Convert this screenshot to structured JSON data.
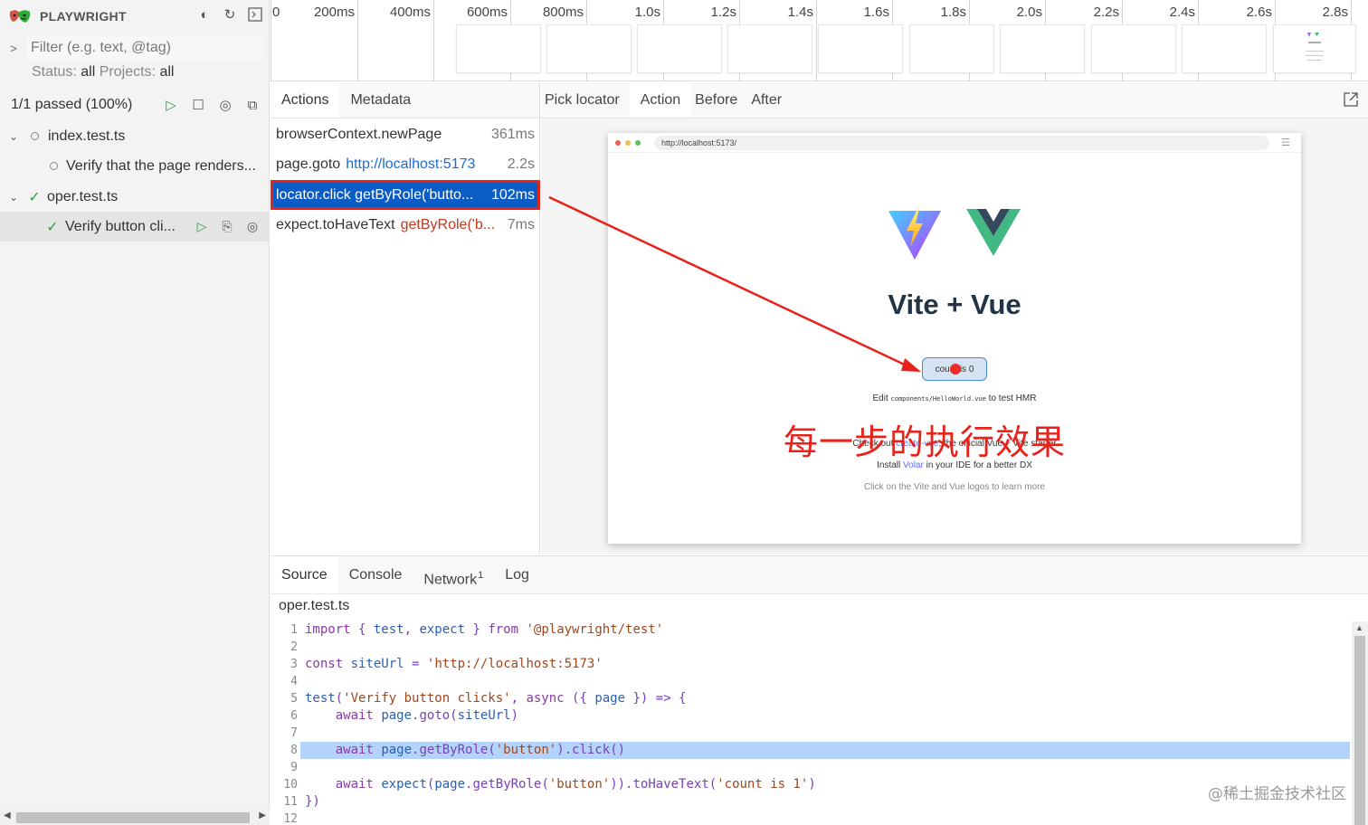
{
  "sidebar": {
    "brand": "PLAYWRIGHT",
    "filter_placeholder": "Filter (e.g. text, @tag)",
    "status_label": "Status:",
    "status_value": "all",
    "projects_label": "Projects:",
    "projects_value": "all",
    "summary": "1/1 passed (100%)",
    "tree": [
      {
        "label": "index.test.ts"
      },
      {
        "label": "Verify that the page renders..."
      },
      {
        "label": "oper.test.ts"
      },
      {
        "label": "Verify button cli..."
      }
    ]
  },
  "timeline": {
    "ticks": [
      "0",
      "200ms",
      "400ms",
      "600ms",
      "800ms",
      "1.0s",
      "1.2s",
      "1.4s",
      "1.6s",
      "1.8s",
      "2.0s",
      "2.2s",
      "2.4s",
      "2.6s",
      "2.8s"
    ]
  },
  "actions_panel": {
    "tabs": [
      "Actions",
      "Metadata"
    ],
    "rows": [
      {
        "method": "browserContext.newPage",
        "arg": "",
        "duration": "361ms"
      },
      {
        "method": "page.goto",
        "arg": "http://localhost:5173",
        "duration": "2.2s"
      },
      {
        "method": "locator.click getByRole('butto...",
        "arg": "",
        "duration": "102ms"
      },
      {
        "method": "expect.toHaveText",
        "arg": "getByRole('b...",
        "duration": "7ms"
      }
    ]
  },
  "snapshot_panel": {
    "tabs": [
      "Pick locator",
      "Action",
      "Before",
      "After"
    ],
    "url": "http://localhost:5173/",
    "title": "Vite + Vue",
    "button_text": "count is 0",
    "edit_pre": "Edit",
    "edit_code": "components/HelloWorld.vue",
    "edit_post": "to test HMR",
    "check_pre": "Check out",
    "check_link": "create-vue",
    "check_post": ", the official Vue + Vite starter",
    "install_pre": "Install",
    "install_link": "Volar",
    "install_post": "in your IDE for a better DX",
    "learn": "Click on the Vite and Vue logos to learn more",
    "annotation": "每一步的执行效果"
  },
  "source_panel": {
    "tabs": [
      "Source",
      "Console",
      "Network",
      "Log"
    ],
    "network_badge": "1",
    "file": "oper.test.ts",
    "highlight_line": 8
  },
  "watermark": "@稀土掘金技术社区",
  "colors": {
    "selected_row": "#0b5cc4",
    "annotation_red": "#e8221b",
    "highlight_line": "#b4d3fb",
    "passed_green": "#2ea043"
  }
}
